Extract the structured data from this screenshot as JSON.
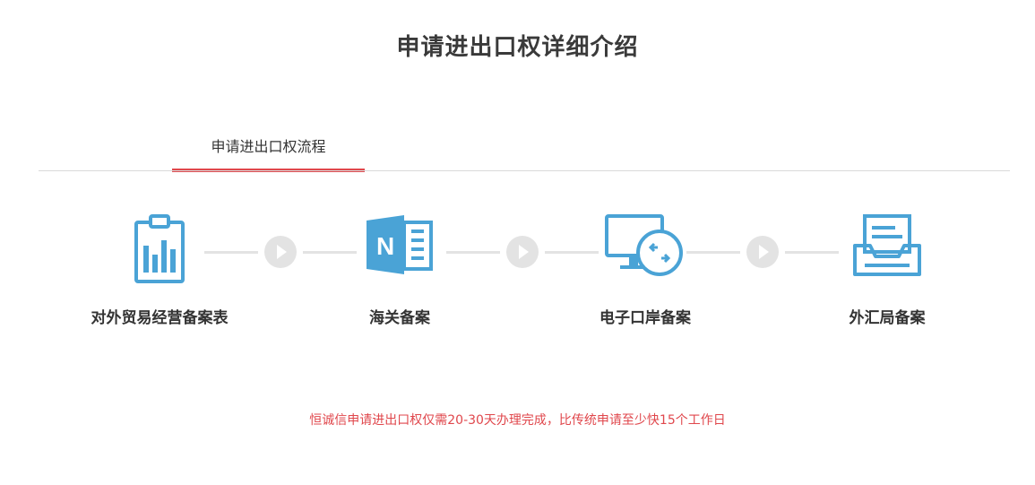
{
  "header": {
    "title": "申请进出口权详细介绍"
  },
  "tabs": [
    {
      "label": "申请进出口权流程",
      "active": true
    }
  ],
  "steps": [
    {
      "label": "对外贸易经营备案表",
      "icon": "clipboard-chart-icon"
    },
    {
      "label": "海关备案",
      "icon": "onenote-notebook-icon"
    },
    {
      "label": "电子口岸备案",
      "icon": "monitor-connection-icon"
    },
    {
      "label": "外汇局备案",
      "icon": "inbox-tray-icon"
    }
  ],
  "note": "恒诚信申请进出口权仅需20-30天办理完成，比传统申请至少快15个工作日",
  "colors": {
    "accent": "#e0474c",
    "icon": "#4aa3d6",
    "connector": "#e3e3e3"
  }
}
